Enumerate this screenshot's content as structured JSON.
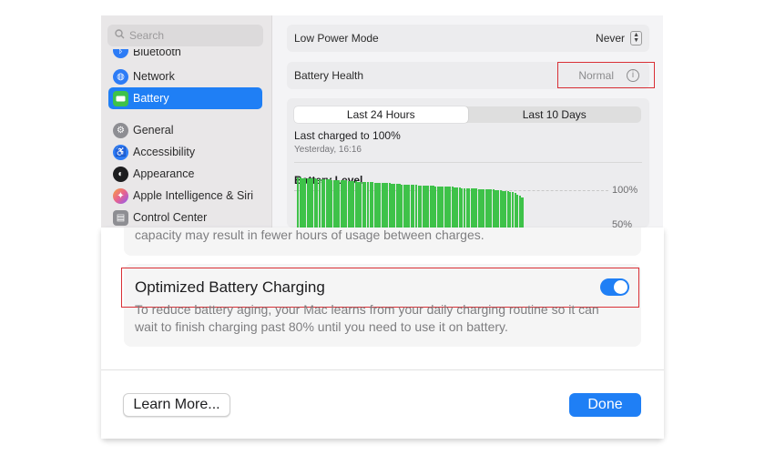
{
  "sidebar": {
    "search_placeholder": "Search",
    "items": [
      {
        "label": "Bluetooth",
        "icon": "bluetooth-icon",
        "color": "#2d7cf6"
      },
      {
        "label": "Network",
        "icon": "globe-icon",
        "color": "#2d7cf6"
      },
      {
        "label": "Battery",
        "icon": "battery-icon",
        "color": "#3ec249",
        "selected": true
      },
      {
        "label": "General",
        "icon": "gear-icon",
        "color": "#8e8e93"
      },
      {
        "label": "Accessibility",
        "icon": "accessibility-icon",
        "color": "#2d7cf6"
      },
      {
        "label": "Appearance",
        "icon": "appearance-icon",
        "color": "#1d1d1f"
      },
      {
        "label": "Apple Intelligence & Siri",
        "icon": "siri-icon",
        "color": "#e8628f"
      },
      {
        "label": "Control Center",
        "icon": "control-center-icon",
        "color": "#8e8e93"
      }
    ]
  },
  "content": {
    "low_power": {
      "label": "Low Power Mode",
      "value": "Never"
    },
    "health": {
      "label": "Battery Health",
      "value": "Normal"
    },
    "history": {
      "tabs": [
        "Last 24 Hours",
        "Last 10 Days"
      ],
      "active_tab": 0,
      "last_charged": "Last charged to 100%",
      "charged_time": "Yesterday, 16:16",
      "chart_title": "Battery Level",
      "axis_top": "100%",
      "axis_mid": "50%"
    }
  },
  "sheet": {
    "note_text": "capacity may result in fewer hours of usage between charges.",
    "optimized": {
      "title": "Optimized Battery Charging",
      "description": "To reduce battery aging, your Mac learns from your daily charging routine so it can wait to finish charging past 80% until you need to use it on battery.",
      "enabled": true
    },
    "learn_more": "Learn More...",
    "done": "Done"
  },
  "colors": {
    "accent": "#1f7ff5",
    "highlight": "#d92f35",
    "battery_bar": "#3ec249"
  },
  "battery_levels": [
    100,
    100,
    99,
    99,
    99,
    98,
    98,
    98,
    97,
    97,
    97,
    96,
    96,
    96,
    95,
    95,
    95,
    95,
    94,
    94,
    94,
    93,
    93,
    93,
    93,
    92,
    92,
    92,
    91,
    91,
    91,
    91,
    90,
    90,
    90,
    90,
    89,
    89,
    89,
    88,
    88,
    88,
    88,
    87,
    87,
    87,
    86,
    86,
    86,
    86,
    85,
    85,
    85,
    85,
    84,
    84,
    84,
    83,
    83,
    83,
    83,
    82,
    82,
    82,
    82,
    81,
    81,
    81,
    80,
    80,
    80,
    80,
    79,
    79,
    79,
    78,
    78,
    78,
    78,
    77,
    77,
    77,
    76,
    76,
    76,
    75,
    75,
    74,
    73,
    72,
    70,
    68,
    66,
    62
  ]
}
